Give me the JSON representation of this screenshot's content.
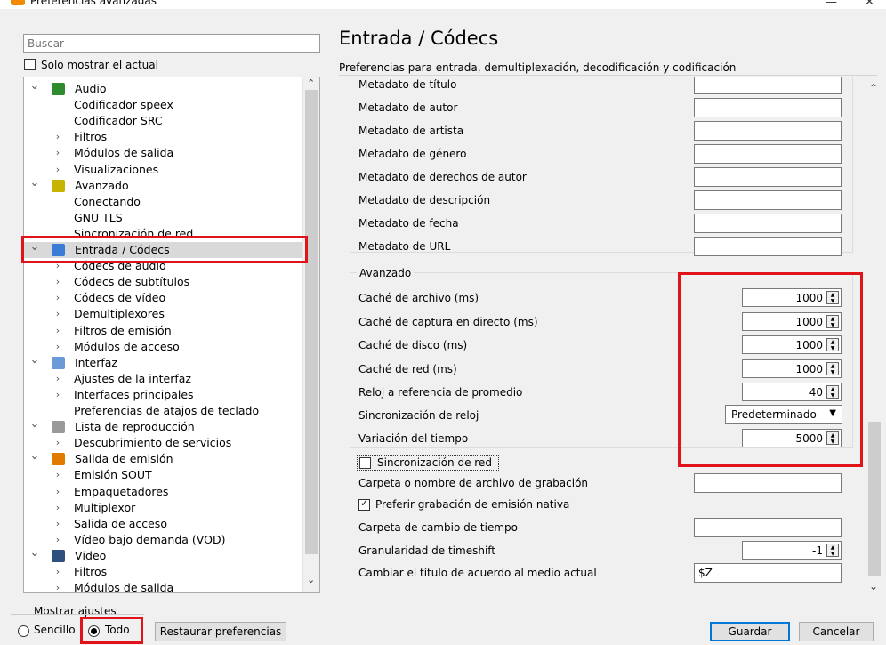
{
  "window": {
    "title": "Preferencias avanzadas",
    "minimize": "—",
    "close": "✕"
  },
  "search": {
    "placeholder": "Buscar"
  },
  "solo_mostrar": "Solo mostrar el actual",
  "tree": [
    {
      "label": "Audio",
      "level": 0,
      "arrow": "down",
      "icon": "audio-icon"
    },
    {
      "label": "Codificador speex",
      "level": 1,
      "arrow": ""
    },
    {
      "label": "Codificador SRC",
      "level": 1,
      "arrow": ""
    },
    {
      "label": "Filtros",
      "level": 1,
      "arrow": "right"
    },
    {
      "label": "Módulos de salida",
      "level": 1,
      "arrow": "right"
    },
    {
      "label": "Visualizaciones",
      "level": 1,
      "arrow": "right"
    },
    {
      "label": "Avanzado",
      "level": 0,
      "arrow": "down",
      "icon": "chip-icon"
    },
    {
      "label": "Conectando",
      "level": 1,
      "arrow": ""
    },
    {
      "label": "GNU TLS",
      "level": 1,
      "arrow": ""
    },
    {
      "label": "Sincronización de red",
      "level": 1,
      "arrow": ""
    },
    {
      "label": "Entrada / Códecs",
      "level": 0,
      "arrow": "down",
      "icon": "codec-icon",
      "selected": true
    },
    {
      "label": "Códecs de audio",
      "level": 1,
      "arrow": "right"
    },
    {
      "label": "Códecs de subtítulos",
      "level": 1,
      "arrow": "right"
    },
    {
      "label": "Códecs de vídeo",
      "level": 1,
      "arrow": "right"
    },
    {
      "label": "Demultiplexores",
      "level": 1,
      "arrow": "right"
    },
    {
      "label": "Filtros de emisión",
      "level": 1,
      "arrow": "right"
    },
    {
      "label": "Módulos de acceso",
      "level": 1,
      "arrow": "right"
    },
    {
      "label": "Interfaz",
      "level": 0,
      "arrow": "down",
      "icon": "interface-icon"
    },
    {
      "label": "Ajustes de la interfaz",
      "level": 1,
      "arrow": "right"
    },
    {
      "label": "Interfaces principales",
      "level": 1,
      "arrow": "right"
    },
    {
      "label": "Preferencias de atajos de teclado",
      "level": 1,
      "arrow": ""
    },
    {
      "label": "Lista de reproducción",
      "level": 0,
      "arrow": "down",
      "icon": "playlist-icon"
    },
    {
      "label": "Descubrimiento de servicios",
      "level": 1,
      "arrow": "right"
    },
    {
      "label": "Salida de emisión",
      "level": 0,
      "arrow": "down",
      "icon": "stream-output-icon"
    },
    {
      "label": "Emisión SOUT",
      "level": 1,
      "arrow": "right"
    },
    {
      "label": "Empaquetadores",
      "level": 1,
      "arrow": "right"
    },
    {
      "label": "Multiplexor",
      "level": 1,
      "arrow": "right"
    },
    {
      "label": "Salida de acceso",
      "level": 1,
      "arrow": "right"
    },
    {
      "label": "Vídeo bajo demanda (VOD)",
      "level": 1,
      "arrow": "right"
    },
    {
      "label": "Vídeo",
      "level": 0,
      "arrow": "down",
      "icon": "video-icon"
    },
    {
      "label": "Filtros",
      "level": 1,
      "arrow": "right"
    },
    {
      "label": "Módulos de salida",
      "level": 1,
      "arrow": "right"
    }
  ],
  "main": {
    "title": "Entrada / Códecs",
    "subtitle": "Preferencias para entrada, demultiplexación, decodificación y codificación",
    "metadata_rows": [
      {
        "label": "Metadato de título",
        "value": ""
      },
      {
        "label": "Metadato de autor",
        "value": ""
      },
      {
        "label": "Metadato de artista",
        "value": ""
      },
      {
        "label": "Metadato de género",
        "value": ""
      },
      {
        "label": "Metadato de derechos de autor",
        "value": ""
      },
      {
        "label": "Metadato de descripción",
        "value": ""
      },
      {
        "label": "Metadato de fecha",
        "value": ""
      },
      {
        "label": "Metadato de URL",
        "value": ""
      }
    ],
    "advanced": {
      "legend": "Avanzado",
      "spins": [
        {
          "label": "Caché de archivo (ms)",
          "value": "1000"
        },
        {
          "label": "Caché de captura en directo (ms)",
          "value": "1000"
        },
        {
          "label": "Caché de disco (ms)",
          "value": "1000"
        },
        {
          "label": "Caché de red (ms)",
          "value": "1000"
        },
        {
          "label": "Reloj a referencia de promedio",
          "value": "40"
        }
      ],
      "clock_sync": {
        "label": "Sincronización de reloj",
        "value": "Predeterminado"
      },
      "jitter": {
        "label": "Variación del tiempo",
        "value": "5000"
      },
      "net_sync": {
        "label": "Sincronización de red",
        "checked": false
      }
    },
    "record_path": {
      "label": "Carpeta o nombre de archivo de grabación",
      "value": ""
    },
    "native_rec": {
      "label": "Preferir grabación de emisión nativa",
      "checked": true
    },
    "timeshift_dir": {
      "label": "Carpeta de cambio de tiempo",
      "value": ""
    },
    "timeshift_gran": {
      "label": "Granularidad de timeshift",
      "value": "-1"
    },
    "title_format": {
      "label": "Cambiar el título de acuerdo al medio actual",
      "value": "$Z"
    }
  },
  "bottom": {
    "show_settings": "Mostrar ajustes",
    "simple": "Sencillo",
    "all": "Todo",
    "reset": "Restaurar preferencias",
    "save": "Guardar",
    "cancel": "Cancelar"
  },
  "colors": {
    "highlight": "#e0131b",
    "selection": "#d9d9d9",
    "accent": "#0078d7"
  }
}
